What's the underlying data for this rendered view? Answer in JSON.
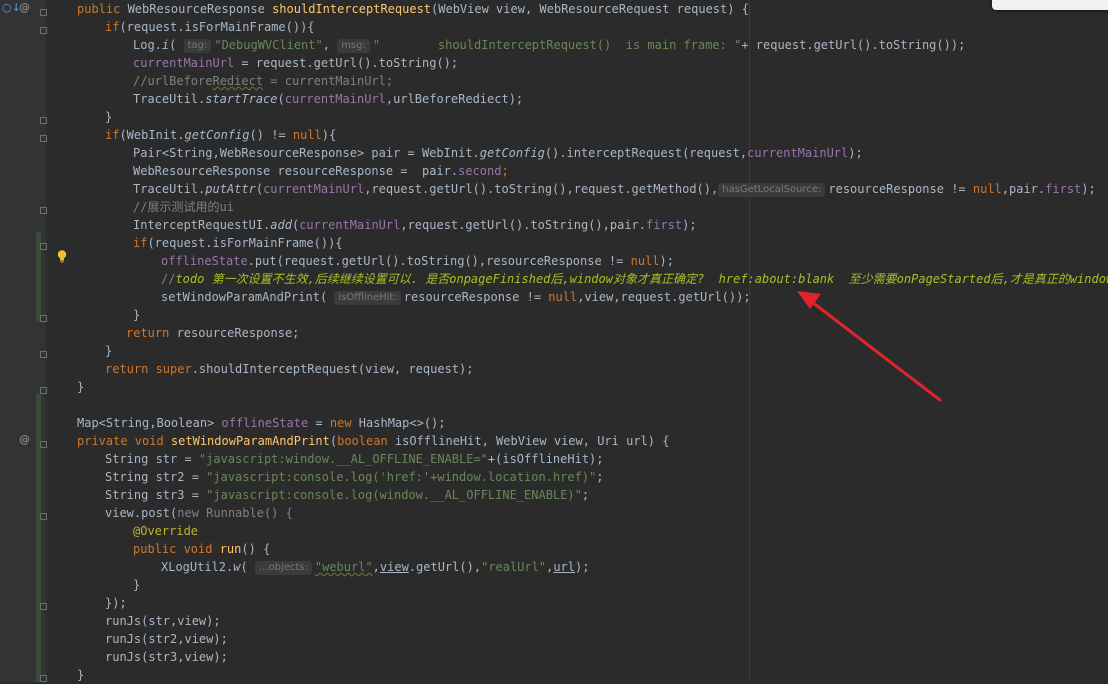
{
  "gutter": {
    "override_marker": "○↓",
    "annotation_marker": "@"
  },
  "lines": {
    "l01": {
      "kw": "public ",
      "type": "WebResourceResponse ",
      "name": "shouldInterceptRequest",
      "params": "(WebView view, WebResourceRequest request) {"
    },
    "l02": {
      "kw": "if",
      "rest": "(request.isForMainFrame()){"
    },
    "l03": {
      "a": "Log.",
      "m": "i",
      "b": "( ",
      "hint1": "tag:",
      "s1": "\"DebugWVClient\"",
      "comma": ", ",
      "hint2": "msg:",
      "s2": "\"        shouldInterceptRequest()  is main frame: \"",
      "c": "+ request.getUrl().toString());"
    },
    "l04": {
      "field": "currentMainUrl",
      "rest": " = request.getUrl().toString();"
    },
    "l05": {
      "p1": "//urlBefore",
      "p2": "Rediect",
      "p3": " = currentMainUrl;"
    },
    "l06": {
      "a": "TraceUtil.",
      "m": "startTrace",
      "b": "(",
      "f1": "currentMainUrl",
      "c": ",urlBeforeRediect);"
    },
    "l07": {
      "text": "}"
    },
    "l08": {
      "kw": "if",
      "a": "(WebInit.",
      "m": "getConfig",
      "b": "() != ",
      "kw2": "null",
      "c": "){"
    },
    "l09": {
      "a": "Pair<String,WebResourceResponse> pair = WebInit.",
      "m": "getConfig",
      "b": "().interceptRequest(request,",
      "f1": "currentMainUrl",
      "c": ");"
    },
    "l10": {
      "a": "WebResourceResponse resourceResponse =  pair.",
      "f1": "second",
      "c": ";"
    },
    "l11": {
      "a": "TraceUtil.",
      "m": "putAttr",
      "b": "(",
      "f1": "currentMainUrl",
      "c": ",request.getUrl().toString(),request.getMethod(),",
      "hint": "hasGetLocalSource:",
      "d": "resourceResponse != ",
      "kw": "null",
      "e": ",pair.",
      "f2": "first",
      "g": ");"
    },
    "l12": {
      "text": "//展示测试用的ui"
    },
    "l13": {
      "a": "InterceptRequestUI.",
      "m": "add",
      "b": "(",
      "f1": "currentMainUrl",
      "c": ",request.getUrl().toString(),pair.",
      "f2": "first",
      "d": ");"
    },
    "l14": {
      "kw": "if",
      "rest": "(request.isForMainFrame()){"
    },
    "l15": {
      "f1": "offlineState",
      "a": ".put(request.getUrl().toString(),resourceResponse != ",
      "kw": "null",
      "b": ");"
    },
    "l16": {
      "a": "//",
      "todo": "todo 第一次设置不生效,后续继续设置可以. 是否onpageFinished后,window对象才真正确定?  href:about:blank  至少需要onPageStarted后,才是真正的window"
    },
    "l17": {
      "a": "setWindowParamAndPrint( ",
      "hint": "isOfflineHit:",
      "b": "resourceResponse != ",
      "kw": "null",
      "c": ",view,request.getUrl());"
    },
    "l18": {
      "text": "}"
    },
    "l19": {
      "kw": "return ",
      "rest": "resourceResponse;"
    },
    "l20": {
      "text": "}"
    },
    "l21": {
      "kw": "return super",
      "rest": ".shouldInterceptRequest(view, request);"
    },
    "l22": {
      "text": "}"
    },
    "l23": {
      "a": "Map<String,Boolean> ",
      "f1": "offlineState",
      "b": " = ",
      "kw": "new ",
      "c": "HashMap<>();"
    },
    "l24": {
      "kw": "private void ",
      "name": "setWindowParamAndPrint",
      "a": "(",
      "kw2": "boolean ",
      "b": "isOfflineHit, WebView view, Uri url) {"
    },
    "l25": {
      "a": "String str = ",
      "s": "\"javascript:window.__AL_OFFLINE_ENABLE=\"",
      "b": "+(isOfflineHit);"
    },
    "l26": {
      "a": "String str2 = ",
      "s": "\"javascript:console.log('href:'+window.location.href)\"",
      "b": ";"
    },
    "l27": {
      "a": "String str3 = ",
      "s": "\"javascript:console.log(window.__AL_OFFLINE_ENABLE)\"",
      "b": ";"
    },
    "l28": {
      "a": "view.post(",
      "kw": "new ",
      "b": "Runnable() {"
    },
    "l29": {
      "ann": "@Override"
    },
    "l30": {
      "kw": "public void ",
      "name": "run",
      "b": "() {"
    },
    "l31": {
      "a": "XLogUtil2.",
      "m": "w",
      "b": "( ",
      "hint": "...objects:",
      "s1": "\"weburl\"",
      "c": ",",
      "v": "view",
      "d": ".getUrl(),",
      "s2": "\"realUrl\"",
      "e": ",",
      "u": "url",
      "f": ");"
    },
    "l32": {
      "text": "}"
    },
    "l33": {
      "text": "});"
    },
    "l34": {
      "text": "runJs(str,view);"
    },
    "l35": {
      "text": "runJs(str2,view);"
    },
    "l36": {
      "text": "runJs(str3,view);"
    },
    "l37": {
      "text": "}"
    }
  },
  "colors": {
    "background": "#2b2b2b",
    "keyword": "#cc7832",
    "method": "#ffc66d",
    "string": "#6a8759",
    "field": "#9876aa",
    "comment": "#808080",
    "todo": "#a8c023",
    "arrow": "#e0242b"
  }
}
